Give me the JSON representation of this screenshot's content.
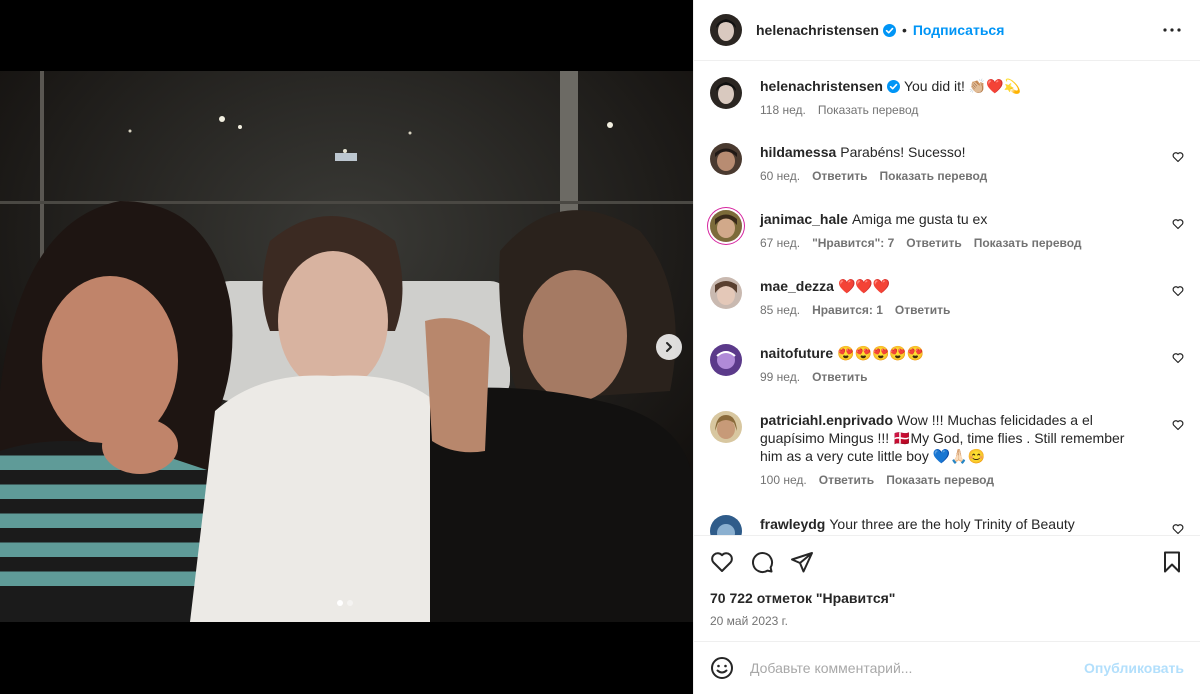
{
  "post": {
    "author": "helenachristensen",
    "follow_label": "Подписаться",
    "separator": "•",
    "caption": {
      "username": "helenachristensen",
      "text": "You did it! 👏🏼❤️💫",
      "age": "118 нед.",
      "translate": "Показать перевод"
    }
  },
  "comments": [
    {
      "username": "hildamessa",
      "text": "Parabéns! Sucesso!",
      "age": "60 нед.",
      "likes": "",
      "reply": "Ответить",
      "translate": "Показать перевод"
    },
    {
      "username": "janimac_hale",
      "text": "Amiga me gusta tu ex",
      "age": "67 нед.",
      "likes": "\"Нравится\": 7",
      "reply": "Ответить",
      "translate": "Показать перевод"
    },
    {
      "username": "mae_dezza",
      "text": "❤️❤️❤️",
      "age": "85 нед.",
      "likes": "Нравится: 1",
      "reply": "Ответить",
      "translate": ""
    },
    {
      "username": "naitofuture",
      "text": "😍😍😍😍😍",
      "age": "99 нед.",
      "likes": "",
      "reply": "Ответить",
      "translate": ""
    },
    {
      "username": "patriciahl.enprivado",
      "text": "Wow !!! Muchas felicidades a el guapísimo Mingus !!! 🇩🇰My God, time flies . Still remember him as a very cute little boy 💙🙏🏻😊",
      "age": "100 нед.",
      "likes": "",
      "reply": "Ответить",
      "translate": "Показать перевод"
    },
    {
      "username": "frawleydg",
      "text": "Your three are the holy Trinity of Beauty",
      "age": "",
      "likes": "",
      "reply": "",
      "translate": ""
    }
  ],
  "stats": {
    "likes": "70 722 отметок \"Нравится\"",
    "date": "20 май 2023 г."
  },
  "add_comment": {
    "placeholder": "Добавьте комментарий...",
    "publish": "Опубликовать"
  },
  "colors": {
    "accent": "#0095f6",
    "publish_disabled": "#b2dffc",
    "verified": "#0095f6"
  },
  "carousel": {
    "slides": 2,
    "active": 1
  }
}
